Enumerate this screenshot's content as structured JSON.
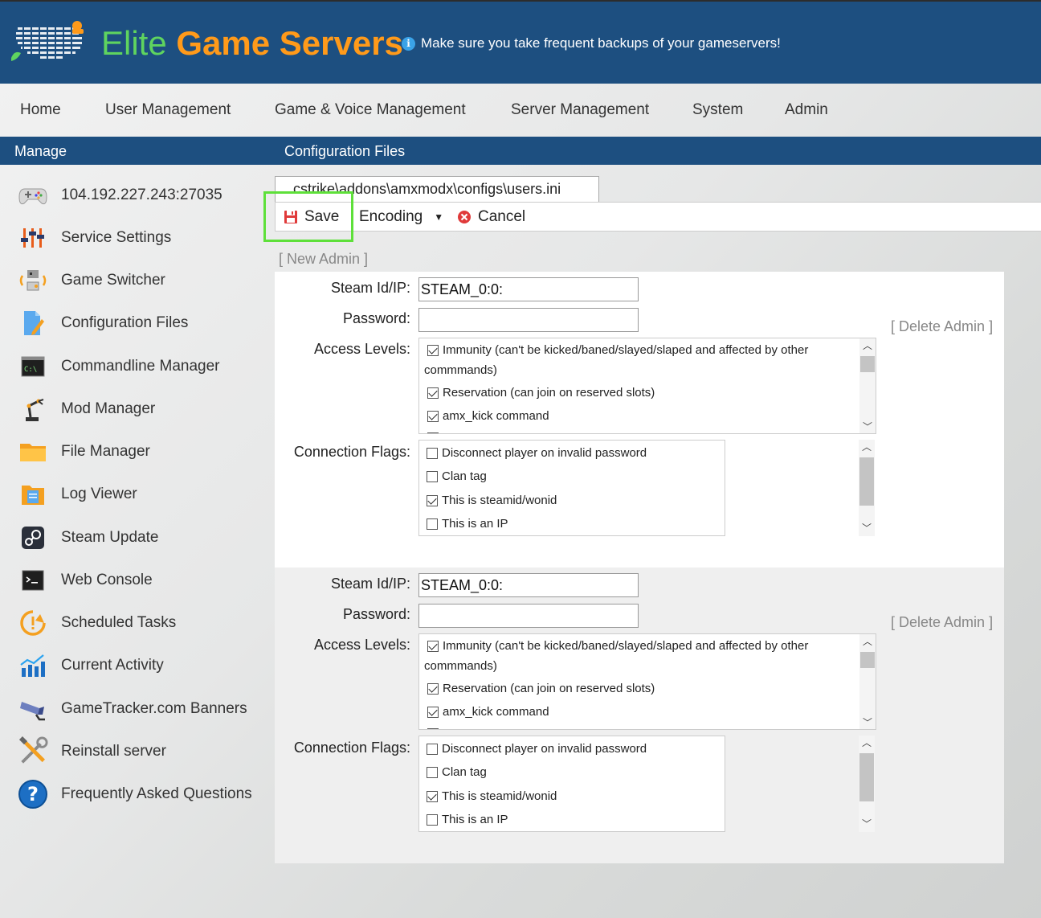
{
  "header": {
    "brand_part1": "Elite",
    "brand_part2": "Game Servers",
    "notice": "Make sure you take frequent backups of your gameservers!"
  },
  "nav": [
    "Home",
    "User Management",
    "Game & Voice Management",
    "Server Management",
    "System",
    "Admin"
  ],
  "bluebar": {
    "left": "Manage",
    "right": "Configuration Files"
  },
  "sidebar": [
    {
      "label": "104.192.227.243:27035",
      "icon": "gamepad-icon"
    },
    {
      "label": "Service Settings",
      "icon": "sliders-icon"
    },
    {
      "label": "Game Switcher",
      "icon": "switch-icon"
    },
    {
      "label": "Configuration Files",
      "icon": "document-edit-icon"
    },
    {
      "label": "Commandline Manager",
      "icon": "terminal-icon"
    },
    {
      "label": "Mod Manager",
      "icon": "robot-arm-icon"
    },
    {
      "label": "File Manager",
      "icon": "folder-icon"
    },
    {
      "label": "Log Viewer",
      "icon": "log-file-icon"
    },
    {
      "label": "Steam Update",
      "icon": "steam-icon"
    },
    {
      "label": "Web Console",
      "icon": "console-icon"
    },
    {
      "label": "Scheduled Tasks",
      "icon": "clock-alert-icon"
    },
    {
      "label": "Current Activity",
      "icon": "activity-chart-icon"
    },
    {
      "label": "GameTracker.com Banners",
      "icon": "cctv-icon"
    },
    {
      "label": "Reinstall server",
      "icon": "tools-icon"
    },
    {
      "label": "Frequently Asked Questions",
      "icon": "help-icon"
    }
  ],
  "editor": {
    "file_tab": "cstrike\\addons\\amxmodx\\configs\\users.ini",
    "save_label": "Save",
    "encoding_label": "Encoding",
    "cancel_label": "Cancel",
    "new_admin": "[ New Admin ]",
    "labels": {
      "steam": "Steam Id/IP:",
      "password": "Password:",
      "access": "Access Levels:",
      "flags": "Connection Flags:",
      "delete": "[ Delete Admin ]"
    },
    "admins": [
      {
        "steam_id": "STEAM_0:0:",
        "password": "",
        "access_levels": [
          {
            "line1": "Immunity (can't be kicked/baned/slayed/slaped and affected by other",
            "line2": "commmands)",
            "checked": true
          },
          {
            "line1": "Reservation (can join on reserved slots)",
            "checked": true
          },
          {
            "line1": "amx_kick command",
            "checked": true
          }
        ],
        "connection_flags": [
          {
            "label": "Disconnect player on invalid password",
            "checked": false
          },
          {
            "label": "Clan tag",
            "checked": false
          },
          {
            "label": "This is steamid/wonid",
            "checked": true
          },
          {
            "label": "This is an IP",
            "checked": false
          }
        ]
      },
      {
        "steam_id": "STEAM_0:0:",
        "password": "",
        "access_levels": [
          {
            "line1": "Immunity (can't be kicked/baned/slayed/slaped and affected by other",
            "line2": "commmands)",
            "checked": true
          },
          {
            "line1": "Reservation (can join on reserved slots)",
            "checked": true
          },
          {
            "line1": "amx_kick command",
            "checked": true
          }
        ],
        "connection_flags": [
          {
            "label": "Disconnect player on invalid password",
            "checked": false
          },
          {
            "label": "Clan tag",
            "checked": false
          },
          {
            "label": "This is steamid/wonid",
            "checked": true
          },
          {
            "label": "This is an IP",
            "checked": false
          }
        ]
      }
    ]
  },
  "colors": {
    "header_blue": "#1d4f80",
    "brand_green": "#5fd45f",
    "brand_orange": "#ff9a1a",
    "highlight": "#5ee03a"
  }
}
